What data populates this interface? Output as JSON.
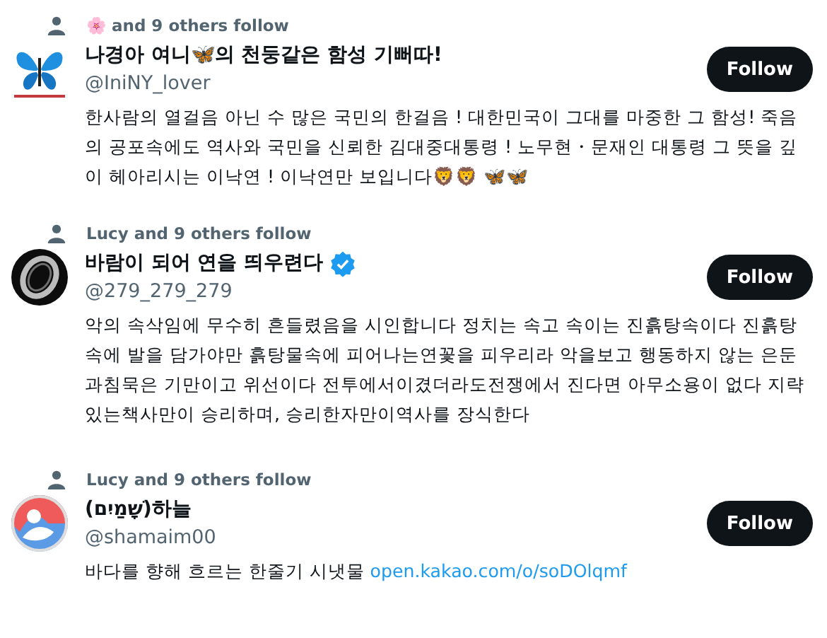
{
  "users": [
    {
      "social_context": "🌸 and 9 others follow",
      "name": "나경아 여니🦋의 천둥같은 함성 기뻐따!",
      "verified": false,
      "handle": "@IniNY_lover",
      "button": "Follow",
      "bio": "한사람의 열걸음 아닌 수 많은 국민의 한걸음 ! 대한민국이 그대를 마중한 그 함성! 죽음의 공포속에도 역사와 국민을 신뢰한 김대중대통령 ! 노무현・문재인 대통령 그 뜻을 깊이 헤아리시는 이낙연 ! 이낙연만 보입니다🦁🦁 🦋🦋"
    },
    {
      "social_context": "Lucy and 9 others follow",
      "name": "바람이 되어 연을 띄우련다",
      "verified": true,
      "handle": "@279_279_279",
      "button": "Follow",
      "bio": "악의 속삭임에 무수히 흔들렸음을 시인합니다 정치는 속고 속이는 진흙탕속이다 진흙탕속에 발을 담가야만 흙탕물속에 피어나는연꽃을 피우리라 악을보고 행동하지 않는 은둔과침묵은 기만이고 위선이다 전투에서이겼더라도전쟁에서 진다면 아무소용이 없다 지략있는책사만이 승리하며, 승리한자만이역사를 장식한다"
    },
    {
      "social_context": "Lucy and 9 others follow",
      "name": "(שָׁמַיִם)하늘",
      "verified": false,
      "handle": "@shamaim00",
      "button": "Follow",
      "bio": "바다를 향해 흐르는 한줄기 시냇물",
      "link": "open.kakao.com/o/soDOlqmf"
    }
  ]
}
